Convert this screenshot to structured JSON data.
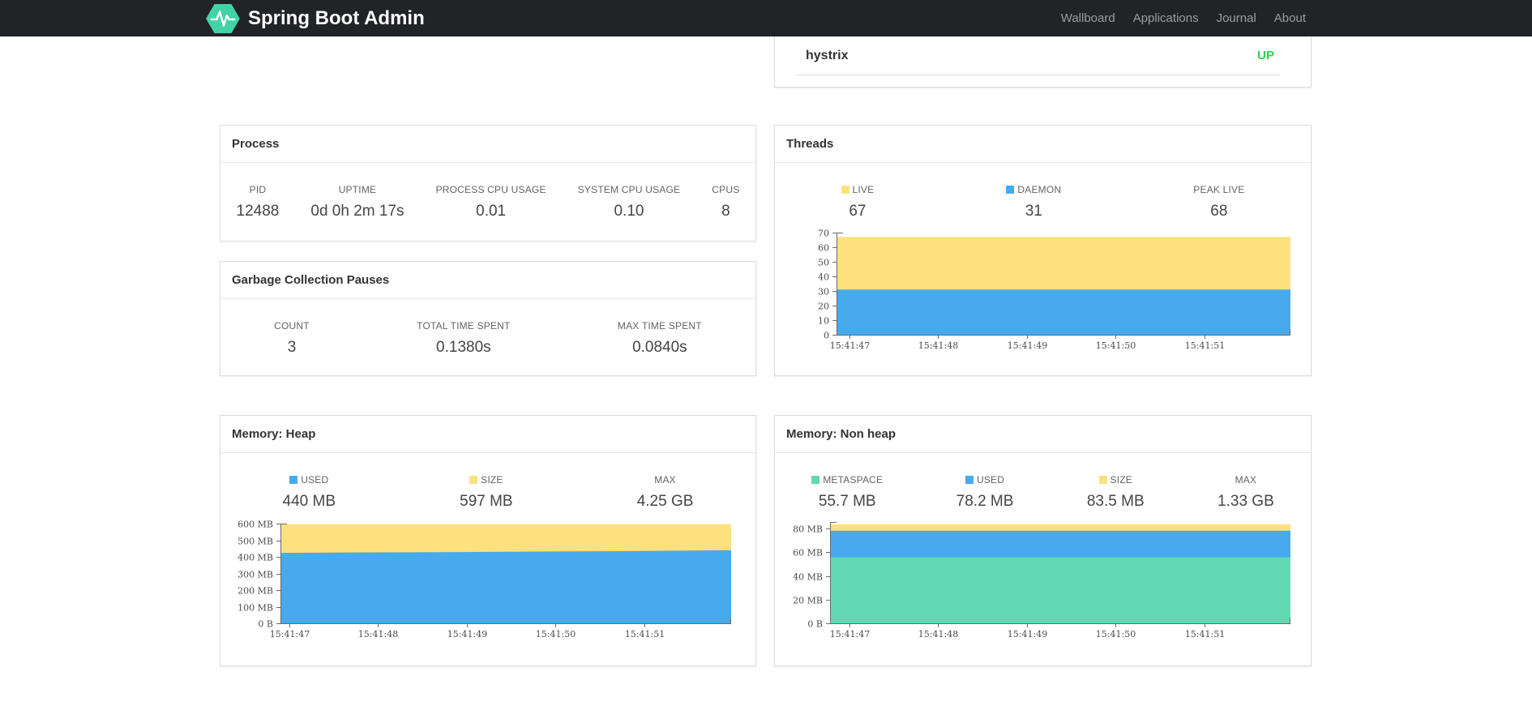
{
  "navbar": {
    "brand": "Spring Boot Admin",
    "brand_color": "#42d3a5",
    "links": [
      {
        "label": "Wallboard"
      },
      {
        "label": "Applications"
      },
      {
        "label": "Journal"
      },
      {
        "label": "About"
      }
    ]
  },
  "application_status": {
    "name": "hystrix",
    "status": "UP",
    "status_color": "#2bd14e"
  },
  "cards": {
    "process": {
      "title": "Process",
      "stats": [
        {
          "label": "PID",
          "value": "12488"
        },
        {
          "label": "UPTIME",
          "value": "0d 0h 2m 17s"
        },
        {
          "label": "PROCESS CPU USAGE",
          "value": "0.01"
        },
        {
          "label": "SYSTEM CPU USAGE",
          "value": "0.10"
        },
        {
          "label": "CPUS",
          "value": "8"
        }
      ]
    },
    "gc": {
      "title": "Garbage Collection Pauses",
      "stats": [
        {
          "label": "COUNT",
          "value": "3"
        },
        {
          "label": "TOTAL TIME SPENT",
          "value": "0.1380s"
        },
        {
          "label": "MAX TIME SPENT",
          "value": "0.0840s"
        }
      ]
    },
    "threads": {
      "title": "Threads",
      "stats": [
        {
          "label": "LIVE",
          "value": "67",
          "marker": "#fce17e"
        },
        {
          "label": "DAEMON",
          "value": "31",
          "marker": "#47aaed"
        },
        {
          "label": "PEAK LIVE",
          "value": "68"
        }
      ]
    },
    "heap": {
      "title": "Memory: Heap",
      "stats": [
        {
          "label": "USED",
          "value": "440 MB",
          "marker": "#47aaed"
        },
        {
          "label": "SIZE",
          "value": "597 MB",
          "marker": "#fce17e"
        },
        {
          "label": "MAX",
          "value": "4.25 GB"
        }
      ]
    },
    "nonheap": {
      "title": "Memory: Non heap",
      "stats": [
        {
          "label": "METASPACE",
          "value": "55.7 MB",
          "marker": "#62d9b2"
        },
        {
          "label": "USED",
          "value": "78.2 MB",
          "marker": "#47aaed"
        },
        {
          "label": "SIZE",
          "value": "83.5 MB",
          "marker": "#fce17e"
        },
        {
          "label": "MAX",
          "value": "1.33 GB"
        }
      ]
    }
  },
  "chart_data": [
    {
      "id": "threads",
      "type": "area",
      "title": "Threads",
      "ylim": [
        0,
        70
      ],
      "grid": false,
      "legend_position": "above-chart",
      "y_ticks": [
        {
          "v": 0,
          "label": "0"
        },
        {
          "v": 10,
          "label": "10"
        },
        {
          "v": 20,
          "label": "20"
        },
        {
          "v": 30,
          "label": "30"
        },
        {
          "v": 40,
          "label": "40"
        },
        {
          "v": 50,
          "label": "50"
        },
        {
          "v": 60,
          "label": "60"
        },
        {
          "v": 70,
          "label": "70"
        }
      ],
      "x_labels": [
        "15:41:47",
        "15:41:48",
        "15:41:49",
        "15:41:50",
        "15:41:51"
      ],
      "x_tick_fracs": [
        0.029,
        0.224,
        0.42,
        0.615,
        0.811
      ],
      "series": [
        {
          "name": "LIVE",
          "color": "#fce17e",
          "values": [
            67,
            67,
            67,
            67,
            67,
            67
          ]
        },
        {
          "name": "DAEMON",
          "color": "#47aaed",
          "values": [
            31,
            31,
            31,
            31,
            31,
            31
          ]
        }
      ]
    },
    {
      "id": "memory-heap",
      "type": "area",
      "title": "Memory: Heap",
      "ylim": [
        0,
        600
      ],
      "grid": false,
      "legend_position": "above-chart",
      "y_ticks": [
        {
          "v": 0,
          "label": "0 B"
        },
        {
          "v": 100,
          "label": "100 MB"
        },
        {
          "v": 200,
          "label": "200 MB"
        },
        {
          "v": 300,
          "label": "300 MB"
        },
        {
          "v": 400,
          "label": "400 MB"
        },
        {
          "v": 500,
          "label": "500 MB"
        },
        {
          "v": 600,
          "label": "600 MB"
        }
      ],
      "x_labels": [
        "15:41:47",
        "15:41:48",
        "15:41:49",
        "15:41:50",
        "15:41:51"
      ],
      "x_tick_fracs": [
        0.019,
        0.216,
        0.413,
        0.61,
        0.807
      ],
      "series": [
        {
          "name": "SIZE",
          "color": "#fce17e",
          "values": [
            597,
            597,
            597,
            597,
            597,
            597
          ]
        },
        {
          "name": "USED",
          "color": "#47aaed",
          "values": [
            424,
            427,
            429,
            432,
            435,
            440
          ]
        }
      ]
    },
    {
      "id": "memory-nonheap",
      "type": "area",
      "title": "Memory: Non heap",
      "ylim": [
        0,
        85.5
      ],
      "grid": false,
      "legend_position": "above-chart",
      "y_ticks": [
        {
          "v": 0,
          "label": "0 B"
        },
        {
          "v": 20,
          "label": "20 MB"
        },
        {
          "v": 40,
          "label": "40 MB"
        },
        {
          "v": 60,
          "label": "60 MB"
        },
        {
          "v": 80,
          "label": "80 MB"
        }
      ],
      "x_labels": [
        "15:41:47",
        "15:41:48",
        "15:41:49",
        "15:41:50",
        "15:41:51"
      ],
      "x_tick_fracs": [
        0.042,
        0.235,
        0.428,
        0.62,
        0.813
      ],
      "series": [
        {
          "name": "SIZE",
          "color": "#fce17e",
          "values": [
            83.5,
            83.5,
            83.5,
            83.5,
            83.5,
            83.5
          ]
        },
        {
          "name": "USED",
          "color": "#47aaed",
          "values": [
            78.2,
            78.2,
            78.2,
            78.2,
            78.2,
            78.2
          ]
        },
        {
          "name": "METASPACE",
          "color": "#62d9b2",
          "values": [
            55.7,
            55.7,
            55.7,
            55.7,
            55.7,
            55.7
          ]
        }
      ]
    }
  ]
}
